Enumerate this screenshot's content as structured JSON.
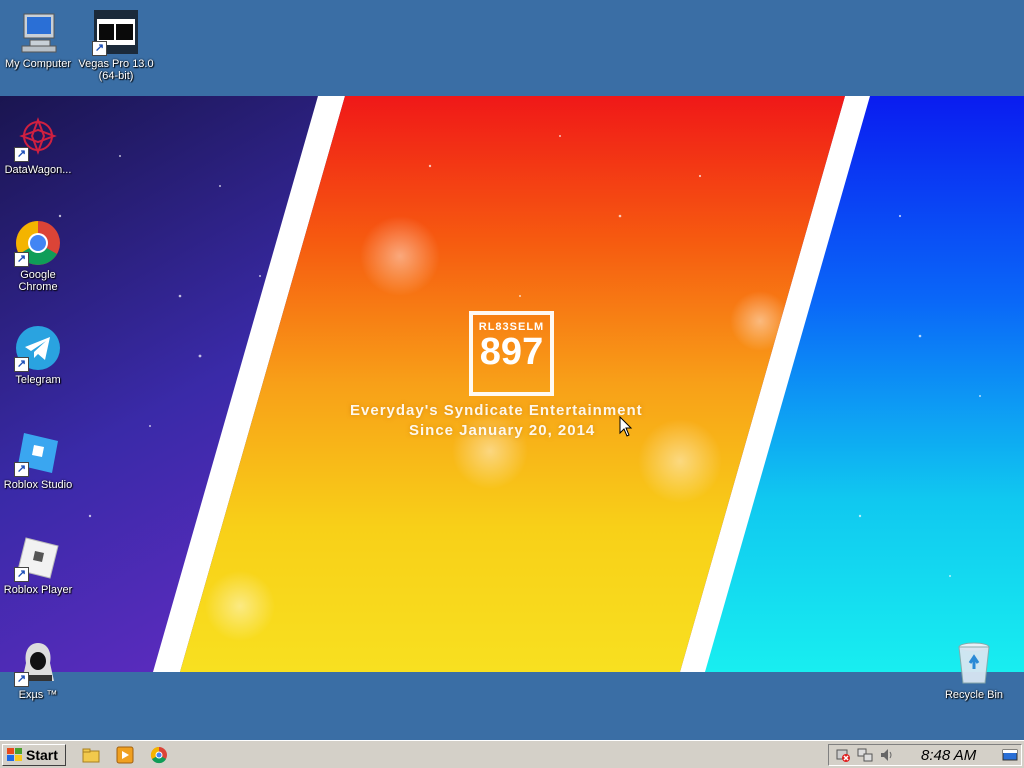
{
  "desktop": {
    "icons": [
      {
        "label": "My Computer",
        "icon": "my-computer-icon"
      },
      {
        "label": "Vegas Pro 13.0\n(64-bit)",
        "icon": "vegas-pro-icon"
      },
      {
        "label": "DataWagon...",
        "icon": "datawagon-icon"
      },
      {
        "label": "Google Chrome",
        "icon": "chrome-icon"
      },
      {
        "label": "Telegram",
        "icon": "telegram-icon"
      },
      {
        "label": "Roblox Studio",
        "icon": "roblox-studio-icon"
      },
      {
        "label": "Roblox Player",
        "icon": "roblox-player-icon"
      },
      {
        "label": "Exµs ™",
        "icon": "exus-icon"
      },
      {
        "label": "Recycle Bin",
        "icon": "recycle-bin-icon"
      }
    ]
  },
  "wallpaper": {
    "logo_top": "RL83SELM",
    "logo_number": "897",
    "tagline_1": "Everyday's Syndicate Entertainment",
    "tagline_2": "Since January 20, 2014"
  },
  "taskbar": {
    "start_label": "Start",
    "quick_launch": [
      "explorer-icon",
      "media-player-icon",
      "chrome-icon"
    ],
    "tray_icons": [
      "network-error-icon",
      "network-icon",
      "volume-icon"
    ],
    "clock": "8:48 AM"
  },
  "colors": {
    "desktop_bg": "#3a6ea5",
    "taskbar_bg": "#d4d0c8"
  }
}
